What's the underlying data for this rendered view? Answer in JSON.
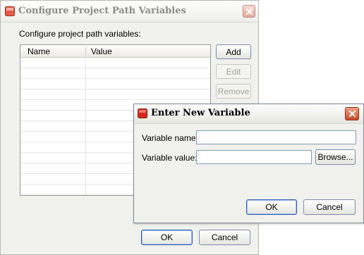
{
  "main_dialog": {
    "title": "Configure Project Path Variables",
    "instruction": "Configure project path variables:",
    "table": {
      "columns": [
        "Name",
        "Value"
      ],
      "rows": [
        [
          "",
          ""
        ],
        [
          "",
          ""
        ],
        [
          "",
          ""
        ],
        [
          "",
          ""
        ],
        [
          "",
          ""
        ],
        [
          "",
          ""
        ],
        [
          "",
          ""
        ],
        [
          "",
          ""
        ],
        [
          "",
          ""
        ],
        [
          "",
          ""
        ],
        [
          "",
          ""
        ],
        [
          "",
          ""
        ],
        [
          "",
          ""
        ],
        [
          "",
          ""
        ]
      ]
    },
    "buttons": {
      "add": "Add",
      "edit": "Edit",
      "remove": "Remove",
      "ok": "OK",
      "cancel": "Cancel"
    },
    "edit_enabled": false,
    "remove_enabled": false,
    "title_state": "inactive"
  },
  "sub_dialog": {
    "title": "Enter New Variable",
    "name_label": "Variable name:",
    "name_value": "",
    "value_label": "Variable value:",
    "value_value": "",
    "buttons": {
      "browse": "Browse...",
      "ok": "OK",
      "cancel": "Cancel"
    },
    "title_state": "active"
  },
  "icons": {
    "app": "app-icon",
    "close": "close-icon"
  },
  "colors": {
    "accent_blue": "#2c5bb8",
    "close_red": "#c84a29",
    "app_red": "#d6281d"
  }
}
